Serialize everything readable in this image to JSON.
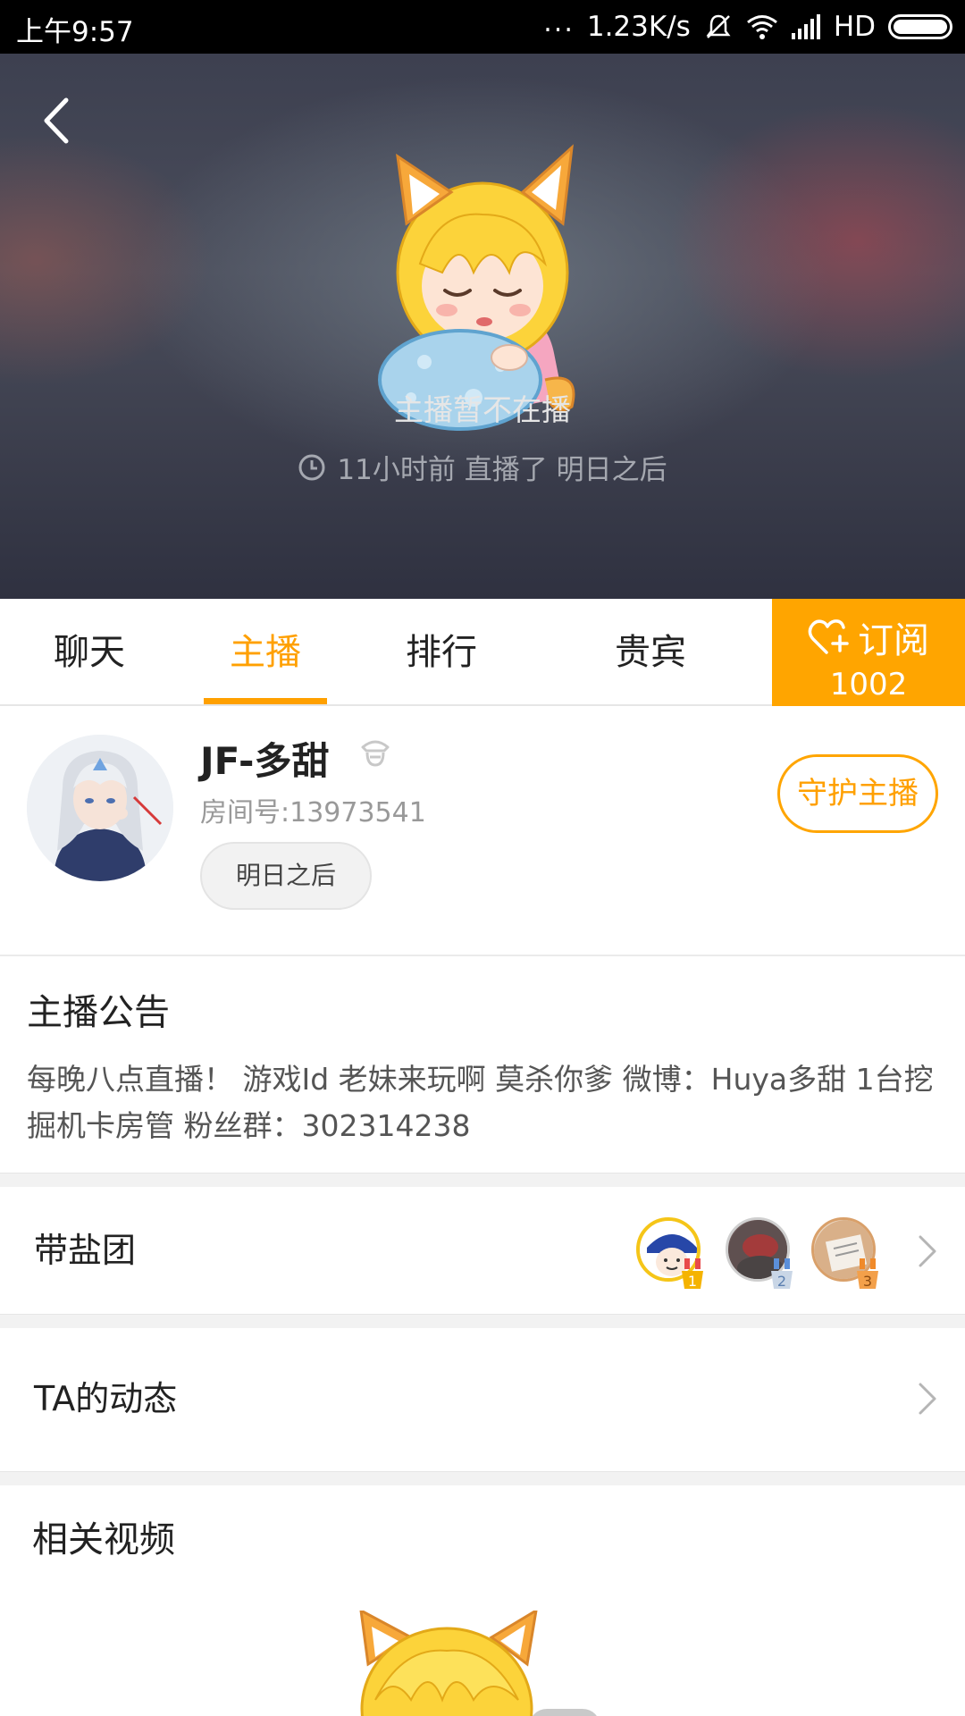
{
  "status_bar": {
    "time": "上午9:57",
    "dots": "...",
    "speed": "1.23K/s",
    "network": "HD"
  },
  "hero": {
    "status": "主播暂不在播",
    "last_live": "11小时前 直播了 明日之后"
  },
  "tabs": [
    {
      "label": "聊天",
      "active": false
    },
    {
      "label": "主播",
      "active": true
    },
    {
      "label": "排行",
      "active": false
    },
    {
      "label": "贵宾",
      "active": false
    }
  ],
  "subscribe": {
    "label": "订阅",
    "count": "1002"
  },
  "anchor": {
    "name": "JF-多甜",
    "room": "房间号:13973541",
    "tag": "明日之后",
    "guard_label": "守护主播"
  },
  "notice": {
    "title": "主播公告",
    "text": "每晚八点直播！ 游戏Id  老妹来玩啊 莫杀你爹 微博：Huya多甜 1台挖掘机卡房管 粉丝群：302314238"
  },
  "fan_group": {
    "label": "带盐团",
    "ranks": [
      "1",
      "2",
      "3"
    ]
  },
  "activity": {
    "label": "TA的动态"
  },
  "related": {
    "title": "相关视频"
  },
  "colors": {
    "accent": "#ffa000",
    "subscribe_bg": "#ffa500",
    "hero_text": "#e6e6e6"
  }
}
